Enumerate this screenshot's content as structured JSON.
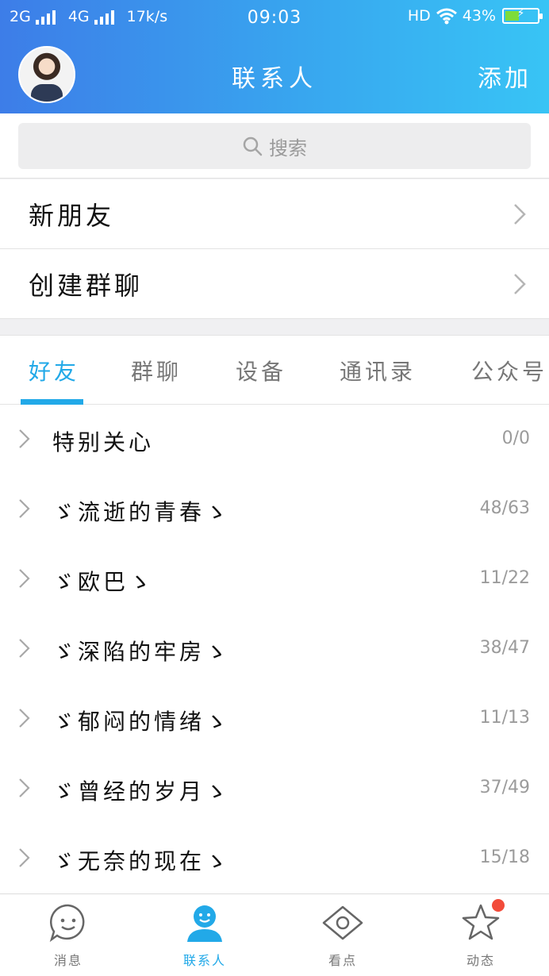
{
  "status_bar": {
    "network1": "2G",
    "network2": "4G",
    "speed": "17k/s",
    "time": "09:03",
    "hd": "HD",
    "battery_text": "43%",
    "battery_level": 0.43
  },
  "header": {
    "title": "联系人",
    "add_label": "添加"
  },
  "search": {
    "placeholder": "搜索"
  },
  "menu": {
    "new_friends": "新朋友",
    "create_group_chat": "创建群聊"
  },
  "tabs": [
    {
      "label": "好友",
      "active": true
    },
    {
      "label": "群聊",
      "active": false
    },
    {
      "label": "设备",
      "active": false
    },
    {
      "label": "通讯录",
      "active": false
    },
    {
      "label": "公众号",
      "active": false
    }
  ],
  "groups": [
    {
      "name": "特别关心",
      "count": "0/0"
    },
    {
      "name": "ゞ流逝的青春ゝ",
      "count": "48/63"
    },
    {
      "name": "ゞ欧巴ゝ",
      "count": "11/22"
    },
    {
      "name": "ゞ深陷的牢房ゝ",
      "count": "38/47"
    },
    {
      "name": "ゞ郁闷的情绪ゝ",
      "count": "11/13"
    },
    {
      "name": "ゞ曾经的岁月ゝ",
      "count": "37/49"
    },
    {
      "name": "ゞ无奈的现在ゝ",
      "count": "15/18"
    }
  ],
  "bottom_nav": [
    {
      "label": "消息",
      "icon": "message-icon",
      "active": false
    },
    {
      "label": "联系人",
      "icon": "contacts-icon",
      "active": true
    },
    {
      "label": "看点",
      "icon": "eye-icon",
      "active": false
    },
    {
      "label": "动态",
      "icon": "star-icon",
      "active": false
    }
  ],
  "colors": {
    "accent": "#22a9e8",
    "header_gradient_start": "#3d7de8",
    "header_gradient_end": "#38c4f5",
    "badge": "#f24b3a"
  }
}
